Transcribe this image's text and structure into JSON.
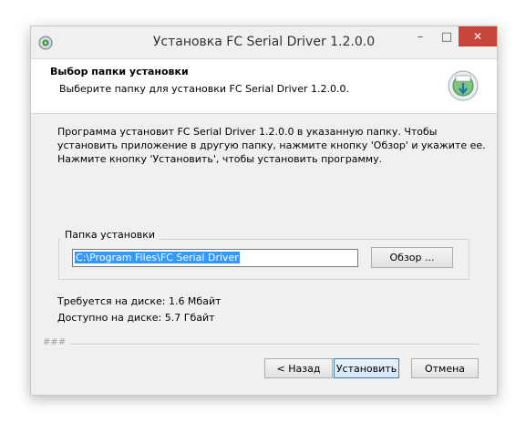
{
  "window": {
    "title": "Установка FC Serial Driver 1.2.0.0",
    "controls": {
      "minimize": "–",
      "maximize": "□",
      "close": "✕"
    }
  },
  "header": {
    "title": "Выбор папки установки",
    "subtitle": "Выберите папку для установки FC Serial Driver 1.2.0.0."
  },
  "description": "Программа установит FC Serial Driver 1.2.0.0 в указанную папку. Чтобы установить приложение в другую папку, нажмите кнопку 'Обзор' и укажите ее. Нажмите кнопку 'Установить', чтобы установить программу.",
  "install_folder": {
    "label": "Папка установки",
    "path": "C:\\Program Files\\FC Serial Driver",
    "browse_label": "Обзор ..."
  },
  "disk": {
    "required": "Требуется на диске: 1.6 Мбайт",
    "available": "Доступно на диске: 5.7 Гбайт"
  },
  "footer": {
    "brand": "###",
    "back_label": "< Назад",
    "install_label": "Установить",
    "cancel_label": "Отмена"
  },
  "colors": {
    "close_button": "#c7443a",
    "selection": "#3399ff",
    "default_button_border": "#3c7fb1"
  },
  "icons": {
    "app": "installer-app-icon",
    "header": "installer-disc-icon"
  }
}
